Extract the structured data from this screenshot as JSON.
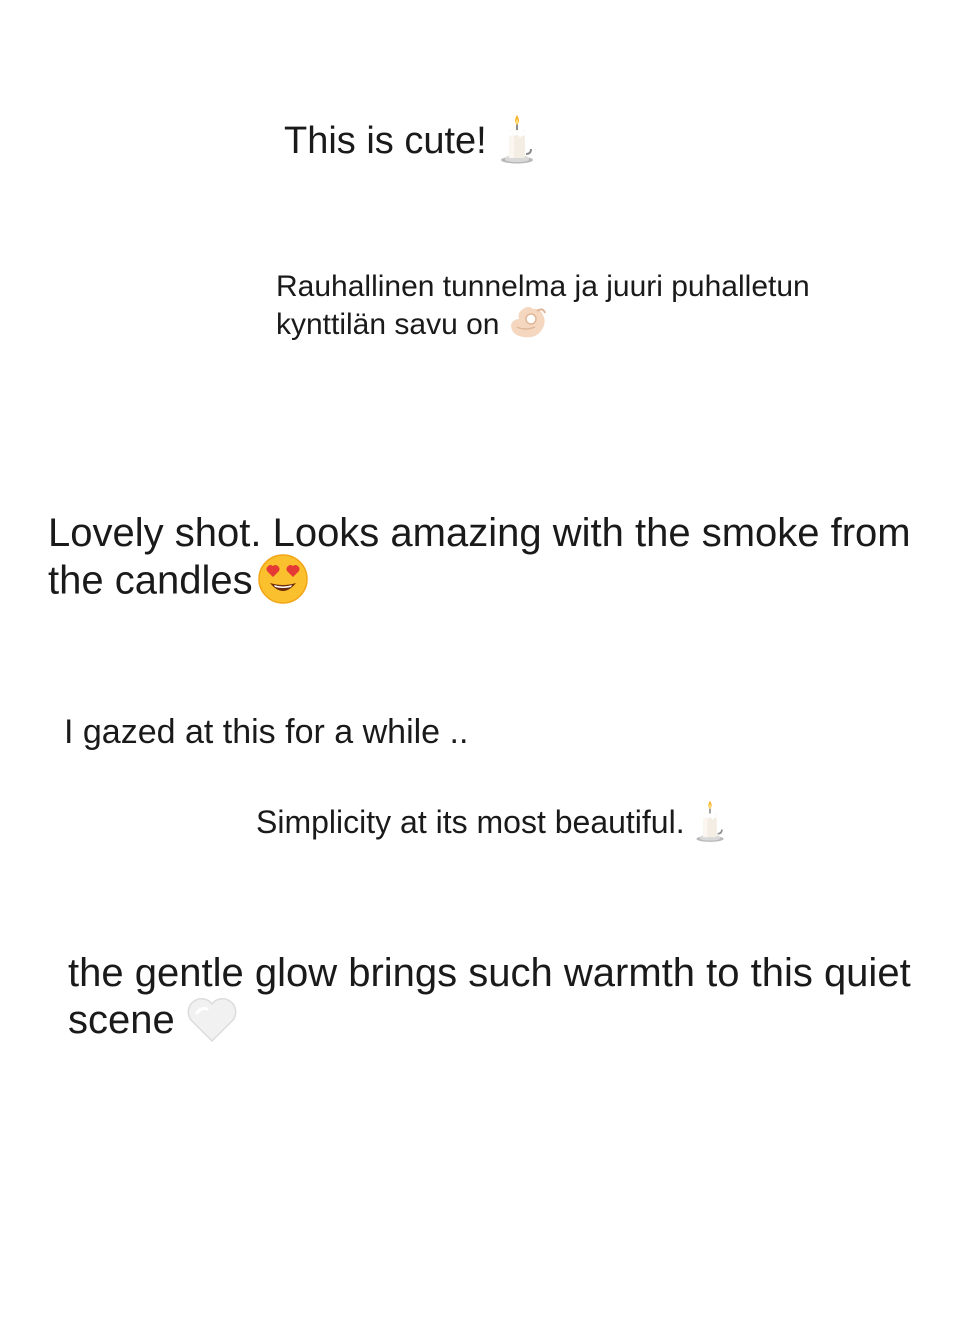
{
  "comments": [
    {
      "text": "This is cute!",
      "emoji": "candle-emoji"
    },
    {
      "text": "Rauhallinen tunnelma ja juuri puhalletun kynttilän savu on",
      "emoji": "ok-hand-emoji"
    },
    {
      "text": "Lovely shot. Looks amazing with the smoke from the candles",
      "emoji": "heart-eyes-emoji"
    },
    {
      "text": "I gazed at this for a while .."
    },
    {
      "text": "Simplicity at its most beautiful.",
      "emoji": "candle-emoji"
    },
    {
      "text": "the gentle glow brings such warmth to this quiet scene",
      "emoji": "white-heart-emoji"
    }
  ],
  "colors": {
    "background": "#ffffff",
    "text": "#1a1a1a"
  }
}
